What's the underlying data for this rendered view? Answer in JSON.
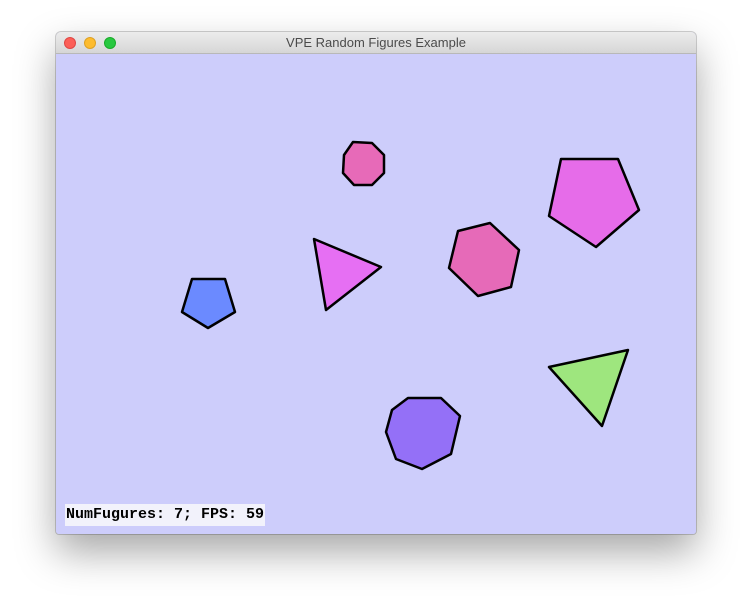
{
  "window": {
    "title": "VPE Random Figures Example",
    "controls": [
      "close",
      "minimize",
      "maximize"
    ]
  },
  "canvas": {
    "background": "#cdcdfb",
    "figures": [
      {
        "shape": "octagon",
        "color": "#e76ab8"
      },
      {
        "shape": "pentagon",
        "color": "#e66ce9"
      },
      {
        "shape": "triangle",
        "color": "#e66ff3"
      },
      {
        "shape": "hexagon",
        "color": "#e66ab8"
      },
      {
        "shape": "pentagon",
        "color": "#6b8aff"
      },
      {
        "shape": "triangle",
        "color": "#9ee67e"
      },
      {
        "shape": "octagon",
        "color": "#9470f7"
      }
    ]
  },
  "status": {
    "text": "NumFugures: 7; FPS: 59"
  }
}
